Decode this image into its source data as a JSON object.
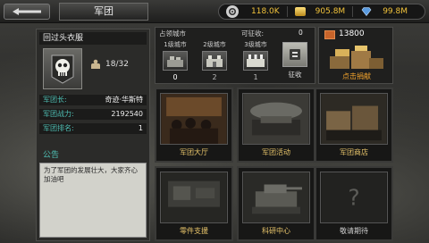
{
  "header": {
    "back_label": "",
    "title": "军团",
    "resources": [
      {
        "icon": "gear-icon",
        "value": "118.0K",
        "color": "#f2c33b"
      },
      {
        "icon": "gold-bar-icon",
        "value": "905.8M",
        "color": "#f2c33b"
      },
      {
        "icon": "diamond-icon",
        "value": "99.8M",
        "color": "#f2c33b"
      }
    ]
  },
  "legion": {
    "name": "回过头衣服",
    "members": "18/32",
    "leader_label": "军团长:",
    "leader_value": "奇迹·华斯特",
    "power_label": "军团战力:",
    "power_value": "2192540",
    "rank_label": "军团排名:",
    "rank_value": "1",
    "notice_title": "公告",
    "notice_text": "为了军团的发展壮大，大家齐心加油吧"
  },
  "cities": {
    "heading": "占领城市",
    "claimable_label": "可征收:",
    "claimable_value": "0",
    "levels": [
      {
        "label": "1级城市",
        "count": "0"
      },
      {
        "label": "2级城市",
        "count": "2"
      },
      {
        "label": "3级城市",
        "count": "1"
      }
    ],
    "collect_label": "征收"
  },
  "donate": {
    "value": "13800",
    "label": "点击捐献"
  },
  "tiles": [
    {
      "label": "军团大厅"
    },
    {
      "label": "军团活动"
    },
    {
      "label": "军团商店"
    },
    {
      "label": "零件支援"
    },
    {
      "label": "科研中心"
    },
    {
      "label": "敬请期待"
    }
  ],
  "colors": {
    "accent_teal": "#4fc0b5",
    "accent_gold": "#e8c56b",
    "donate_orange": "#f0a22c"
  }
}
